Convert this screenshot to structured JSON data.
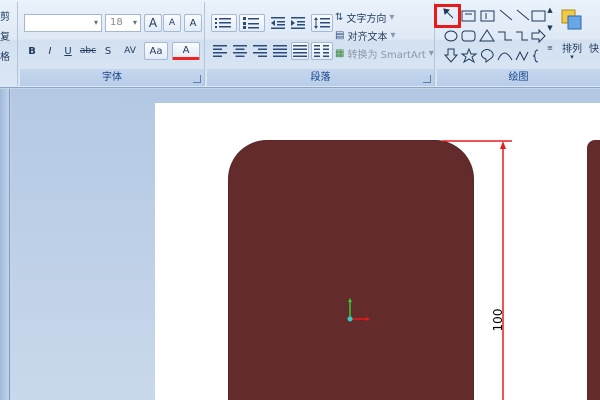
{
  "ribbon": {
    "clipboard_partial": {
      "items": [
        "剪",
        "复",
        "格"
      ]
    },
    "font": {
      "label": "字体",
      "font_name_value": "",
      "font_size_value": "18",
      "buttons": {
        "grow": "A",
        "shrink": "A",
        "clear": "A",
        "bold": "B",
        "italic": "I",
        "underline": "U",
        "strike": "abc",
        "shadow": "S",
        "spacing": "AV",
        "case": "Aa",
        "color": "A"
      }
    },
    "paragraph": {
      "label": "段落",
      "text_direction": "文字方向",
      "align_text": "对齐文本",
      "convert_smartart": "转换为 SmartArt"
    },
    "drawing": {
      "label": "绘图",
      "arrange": "排列",
      "quick_styles": "快"
    }
  },
  "canvas": {
    "dimension_label": "100"
  },
  "colors": {
    "shape_fill": "#632b2b",
    "dimension_line": "#e81b1b",
    "highlight": "#e81b1b"
  }
}
